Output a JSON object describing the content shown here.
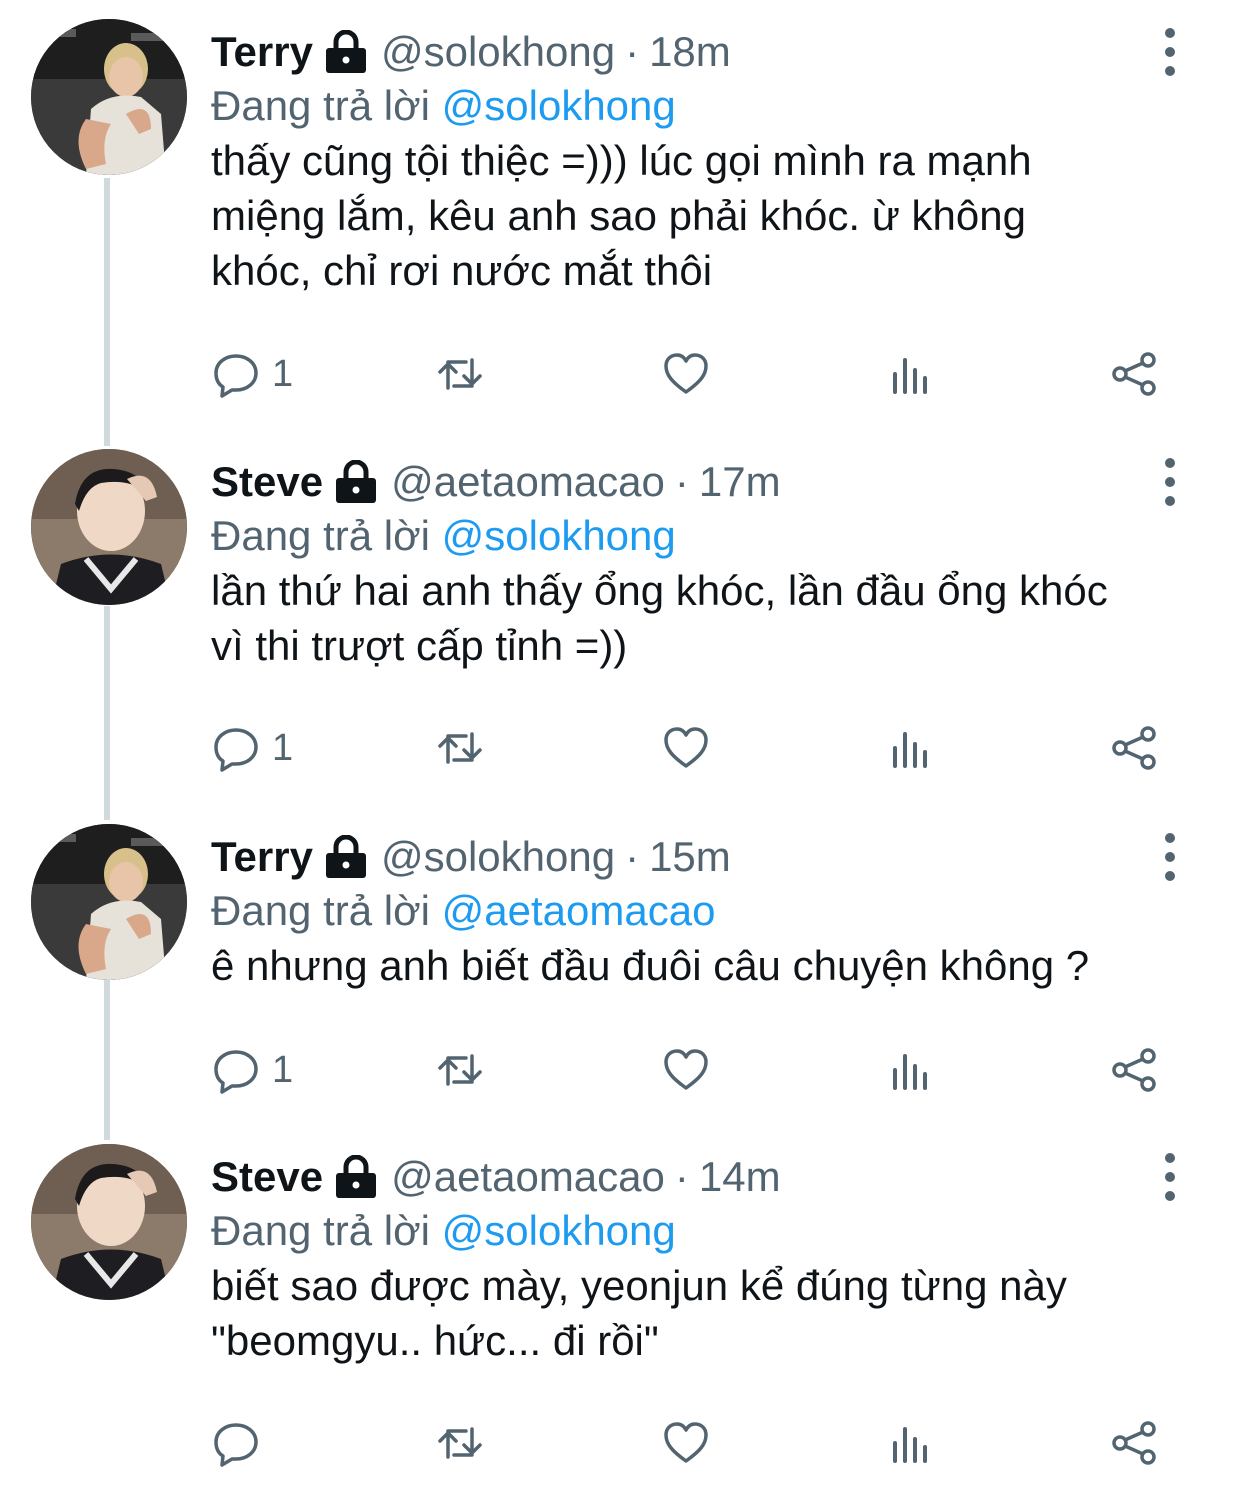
{
  "labels": {
    "replying_to": "Đang trả lời",
    "dot": "·"
  },
  "colors": {
    "text": "#0f1419",
    "secondary": "#536471",
    "link": "#1d9bf0",
    "thread_line": "#cfd9de"
  },
  "tweets": [
    {
      "name": "Terry",
      "locked": true,
      "handle": "@solokhong",
      "time": "18m",
      "reply_to": "@solokhong",
      "text_lines": [
        "thấy cũng tội thiệc =))) lúc gọi mình ra mạnh",
        "miệng lắm, kêu anh sao phải khóc. ừ không",
        "khóc, chỉ rơi nước mắt thôi"
      ],
      "reply_count": "1",
      "avatar": "avatar-terry"
    },
    {
      "name": "Steve",
      "locked": true,
      "handle": "@aetaomacao",
      "time": "17m",
      "reply_to": "@solokhong",
      "text_lines": [
        "lần thứ hai anh thấy ổng khóc, lần đầu ổng khóc",
        "vì thi trượt cấp tỉnh =))"
      ],
      "reply_count": "1",
      "avatar": "avatar-steve"
    },
    {
      "name": "Terry",
      "locked": true,
      "handle": "@solokhong",
      "time": "15m",
      "reply_to": "@aetaomacao",
      "text_lines": [
        "ê nhưng anh biết đầu đuôi câu chuyện không ?"
      ],
      "reply_count": "1",
      "avatar": "avatar-terry"
    },
    {
      "name": "Steve",
      "locked": true,
      "handle": "@aetaomacao",
      "time": "14m",
      "reply_to": "@solokhong",
      "text_lines": [
        "biết sao được mày, yeonjun kể đúng từng này",
        "\"beomgyu.. hức... đi rồi\""
      ],
      "reply_count": "",
      "avatar": "avatar-steve"
    }
  ]
}
